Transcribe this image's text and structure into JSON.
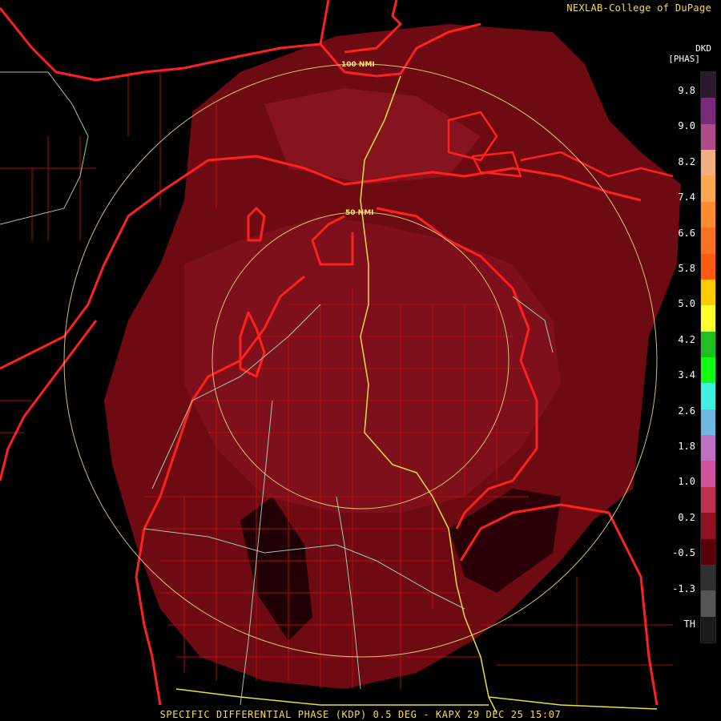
{
  "credit": "NEXLAB-College of DuPage",
  "legend": {
    "title_line1": "DKD",
    "title_line2": "[PHAS]",
    "ticks": [
      "9.8",
      "9.0",
      "8.2",
      "7.4",
      "6.6",
      "5.8",
      "5.0",
      "4.2",
      "3.4",
      "2.6",
      "1.8",
      "1.0",
      "0.2",
      "-0.5",
      "-1.3",
      "TH"
    ],
    "colors": [
      "#2b1a2b",
      "#7a2a7a",
      "#b04a8a",
      "#f2b080",
      "#ffa850",
      "#ff8c30",
      "#ff7020",
      "#ff5a10",
      "#ffcc00",
      "#ffff30",
      "#20c020",
      "#10ff10",
      "#40f0e0",
      "#70b8e0",
      "#c070c0",
      "#d050a0",
      "#c03050",
      "#901020",
      "#5a0008",
      "#303030",
      "#555555",
      "#1a1a1a"
    ]
  },
  "rings": {
    "inner_label": "50 NMI",
    "outer_label": "100 NMI"
  },
  "footer": "SPECIFIC DIFFERENTIAL PHASE (KDP) 0.5 DEG - KAPX 29 DEC 25 15:07",
  "colors": {
    "echo": "#6e0a12",
    "echo_light": "#86141e",
    "coast": "#ff2020",
    "county": "#d01010",
    "highway": "#e8e040",
    "road": "#a8e0c0",
    "ring": "#f0e090"
  }
}
